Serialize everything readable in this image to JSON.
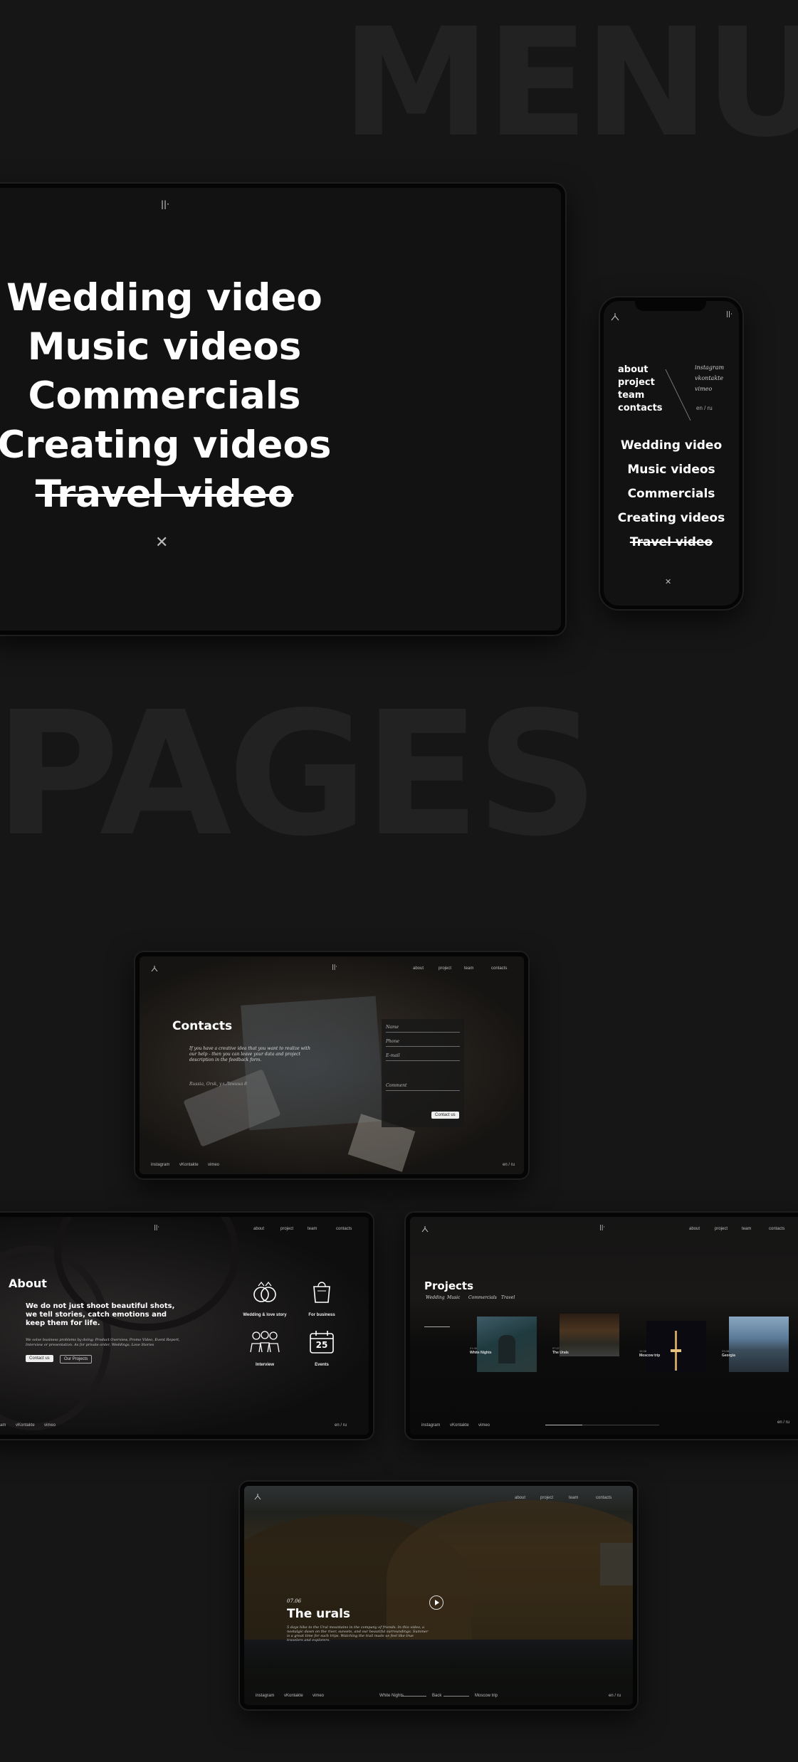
{
  "headings": {
    "menu": "MENU",
    "pages": "PAGES"
  },
  "menu_screen": {
    "items": [
      "Wedding video",
      "Music videos",
      "Commercials",
      "Creating videos",
      "Travel video"
    ],
    "logo": "||·",
    "close": "✕"
  },
  "mobile_menu": {
    "nav": [
      "about",
      "project",
      "team",
      "contacts"
    ],
    "social": [
      "instagram",
      "vkontakte",
      "vimeo"
    ],
    "lang": "en / ru",
    "items": [
      "Wedding video",
      "Music videos",
      "Commercials",
      "Creating videos",
      "Travel video"
    ],
    "close": "✕"
  },
  "site_nav": [
    "about",
    "project",
    "team",
    "contacts"
  ],
  "footer": {
    "social": [
      "instagram",
      "vKontakte",
      "vimeo"
    ],
    "lang": "en / ru"
  },
  "contacts_page": {
    "title": "Contacts",
    "intro": "If you have a creative idea that you want to realize with our help - then you can leave your data and project description in the feedback form.",
    "address": "Russia, Orsk, ул.Ленина 8",
    "fields": [
      "Name",
      "Phone",
      "E-mail",
      "Comment"
    ],
    "submit": "Contact us"
  },
  "about_page": {
    "title": "About",
    "headline": "We do not just shoot beautiful shots, we tell stories, catch emotions and keep them for life.",
    "description": "We solve business problems by doing: Product Overview, Promo Video, Event Report, Interview or presentation. As for private order, Weddings, Love Stories",
    "button_contact": "Contact us",
    "button_projects": "Our Projects",
    "services": [
      {
        "label": "Wedding & love story",
        "icon": "rings-icon"
      },
      {
        "label": "For business",
        "icon": "bag-icon"
      },
      {
        "label": "Interview",
        "icon": "people-icon"
      },
      {
        "label": "Events",
        "icon": "calendar-icon",
        "day": "25"
      }
    ]
  },
  "projects_page": {
    "title": "Projects",
    "filters": [
      "Wedding",
      "Music",
      "Commercials",
      "Travel"
    ],
    "cards": [
      {
        "name": "White Nights",
        "date": "21.06"
      },
      {
        "name": "The Urals",
        "date": "07.07"
      },
      {
        "name": "Moscow trip",
        "date": "15.08"
      },
      {
        "name": "Georgia",
        "date": "23.08"
      }
    ]
  },
  "urals_page": {
    "date": "07.06",
    "title": "The urals",
    "description": "5 days hike to the Ural mountains in the company of friends. In this video, a nostalgic dawn on the river, sunsets, and our beautiful surroundings. Summer is a great time for such trips. Watching the trail made us feel like true travelers and explorers.",
    "prev_label": "White Nights",
    "back_label": "Back",
    "next_label": "Moscow trip"
  },
  "colors": {
    "background": "#161616",
    "heading_ghost": "#222222",
    "text": "#ffffff"
  }
}
